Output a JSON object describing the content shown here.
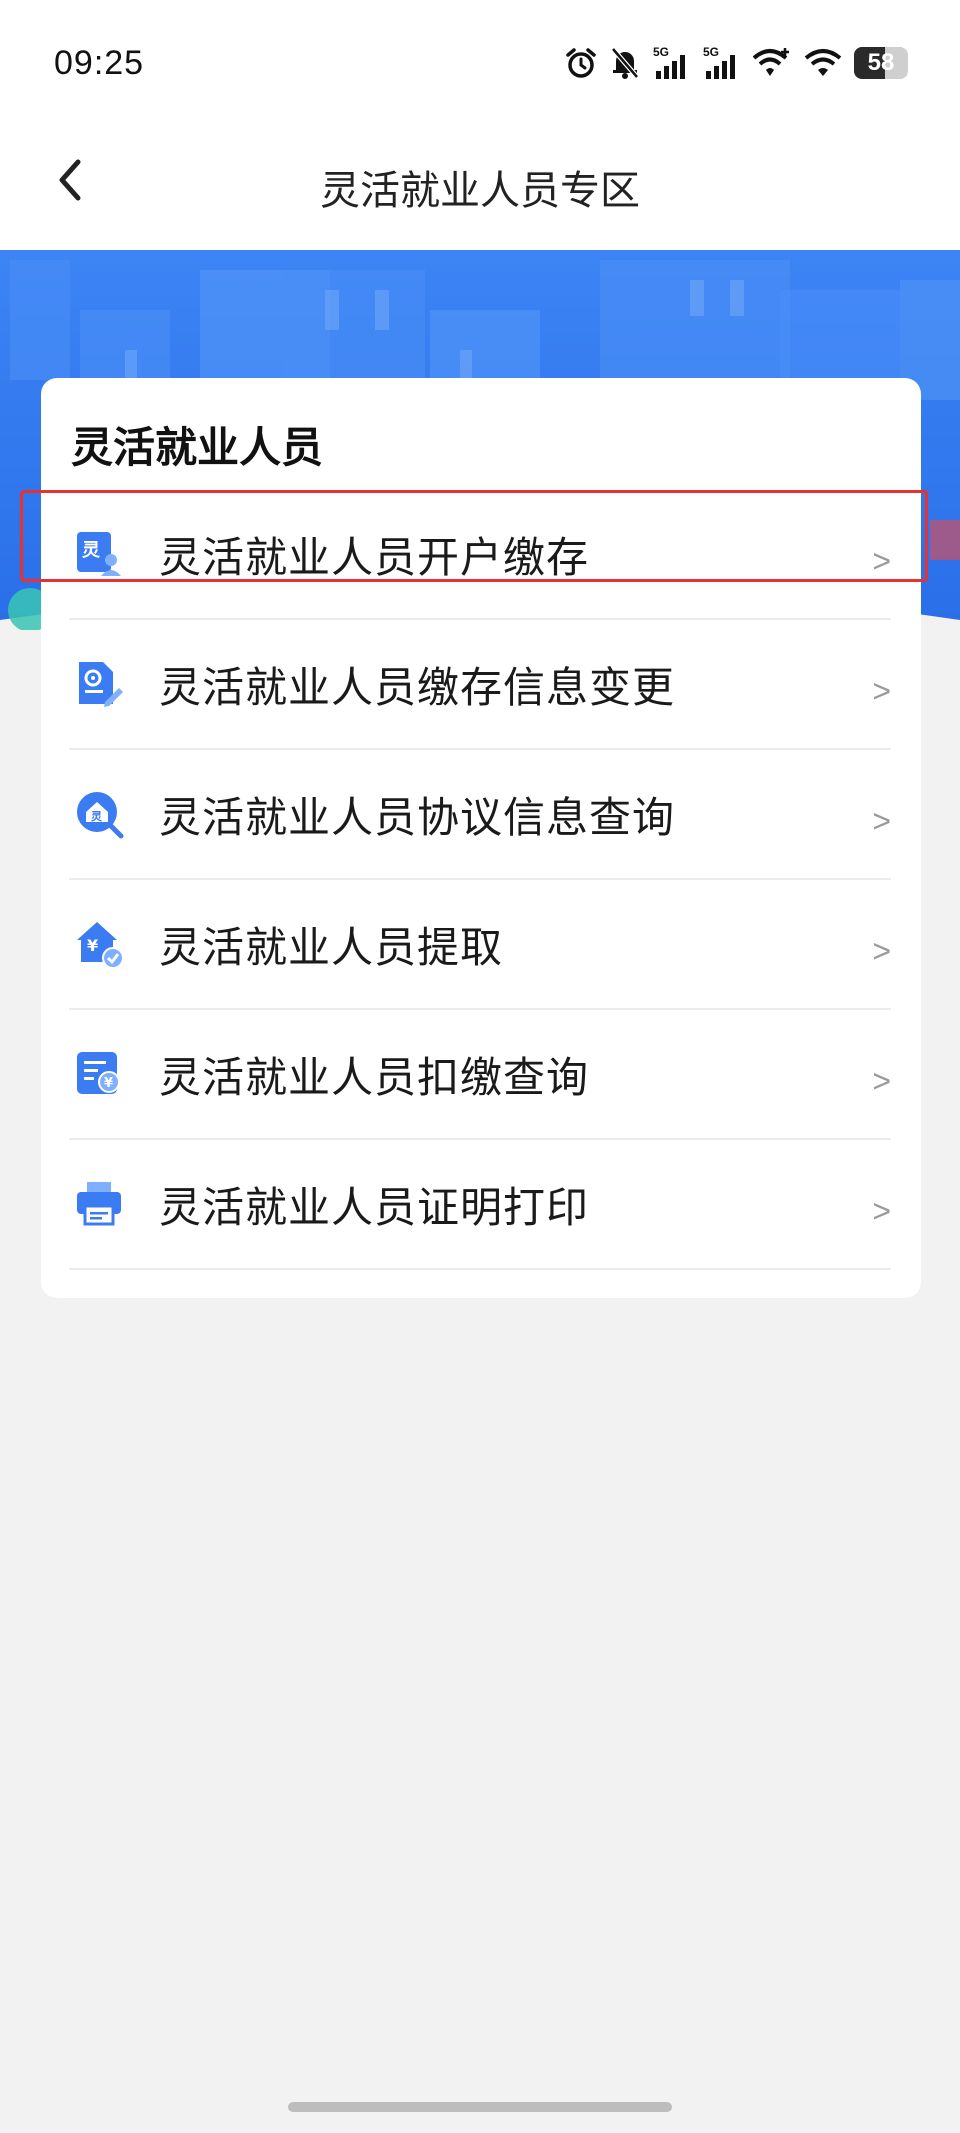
{
  "status_bar": {
    "time": "09:25",
    "battery": "58",
    "battery_level": 0.58,
    "icons": [
      "alarm-icon",
      "bell-off-icon",
      "signal-5g-icon",
      "signal-5g-icon",
      "wifi-plus-icon",
      "wifi-icon",
      "battery-icon"
    ],
    "signal_label": "5G"
  },
  "nav": {
    "back_icon": "chevron-left-icon",
    "title": "灵活就业人员专区"
  },
  "section": {
    "title": "灵活就业人员",
    "items": [
      {
        "label": "灵活就业人员开户缴存",
        "icon": "account-open-icon",
        "arrow": ">"
      },
      {
        "label": "灵活就业人员缴存信息变更",
        "icon": "document-edit-icon",
        "arrow": ">"
      },
      {
        "label": "灵活就业人员协议信息查询",
        "icon": "agreement-search-icon",
        "arrow": ">"
      },
      {
        "label": "灵活就业人员提取",
        "icon": "house-yuan-icon",
        "arrow": ">"
      },
      {
        "label": "灵活就业人员扣缴查询",
        "icon": "bill-yuan-icon",
        "arrow": ">"
      },
      {
        "label": "灵活就业人员证明打印",
        "icon": "printer-icon",
        "arrow": ">"
      }
    ]
  },
  "colors": {
    "accent": "#3b7cf2",
    "banner": "#2f7af0",
    "highlight": "#e8322d",
    "background": "#f2f2f2"
  }
}
